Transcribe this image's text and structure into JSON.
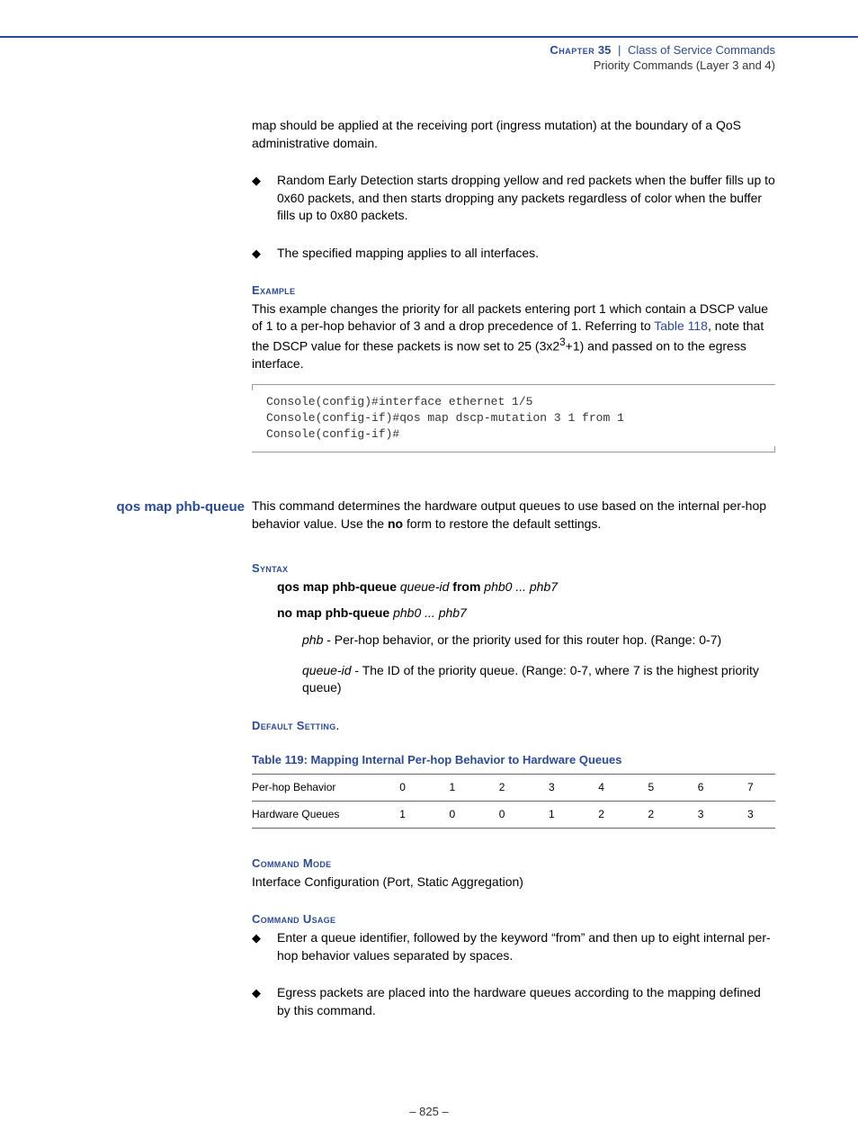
{
  "header": {
    "chapter_label": "Chapter",
    "chapter_num": "35",
    "sep": "|",
    "chapter_title": "Class of Service Commands",
    "subtitle": "Priority Commands (Layer 3 and 4)"
  },
  "intro": {
    "para1": "map should be applied at the receiving port (ingress mutation) at the boundary of a QoS administrative domain.",
    "bullet1": "Random Early Detection starts dropping yellow and red packets when the buffer fills up to 0x60 packets, and then starts dropping any packets regardless of color when the buffer fills up to 0x80 packets.",
    "bullet2": "The specified mapping applies to all interfaces."
  },
  "example": {
    "heading": "Example",
    "text_before_link": "This example changes the priority for all packets entering port 1 which contain a DSCP value of 1 to a per-hop behavior of 3 and a drop precedence of 1. Referring to ",
    "link": "Table 118",
    "text_after_link": ", note that the DSCP value for these packets is now set to 25 (3x2",
    "sup": "3",
    "text_tail": "+1) and passed on to the egress interface.",
    "code": "Console(config)#interface ethernet 1/5\nConsole(config-if)#qos map dscp-mutation 3 1 from 1\nConsole(config-if)#"
  },
  "command": {
    "name": "qos map phb-queue",
    "desc_before_bold": "This command determines the hardware output queues to use based on the internal per-hop behavior value. Use the ",
    "bold_word": "no",
    "desc_after_bold": " form to restore the default settings."
  },
  "syntax": {
    "heading": "Syntax",
    "line1": {
      "b1": "qos map phb-queue",
      "i1": "queue-id",
      "b2": "from",
      "i2": "phb0 ... phb7"
    },
    "line2": {
      "b1": "no map phb-queue",
      "i1": "phb0 ... phb7"
    },
    "param1": {
      "name": "phb",
      "desc": " - Per-hop behavior, or the priority used for this router hop. (Range: 0-7)"
    },
    "param2": {
      "name": "queue-id",
      "desc": " - The ID of the priority queue. (Range: 0-7, where 7 is the highest priority queue)"
    }
  },
  "default_setting": {
    "heading": "Default Setting",
    "dot": "."
  },
  "table": {
    "title": "Table 119: Mapping Internal Per-hop Behavior to Hardware Queues",
    "row1_label": "Per-hop Behavior",
    "row1": [
      "0",
      "1",
      "2",
      "3",
      "4",
      "5",
      "6",
      "7"
    ],
    "row2_label": "Hardware Queues",
    "row2": [
      "1",
      "0",
      "0",
      "1",
      "2",
      "2",
      "3",
      "3"
    ]
  },
  "command_mode": {
    "heading": "Command Mode",
    "text": "Interface Configuration (Port, Static Aggregation)"
  },
  "command_usage": {
    "heading": "Command Usage",
    "bullet1": "Enter a queue identifier, followed by the keyword “from” and then up to eight internal per-hop behavior values separated by spaces.",
    "bullet2": "Egress packets are placed into the hardware queues according to the mapping defined by this command."
  },
  "footer": {
    "page": "–  825  –"
  }
}
